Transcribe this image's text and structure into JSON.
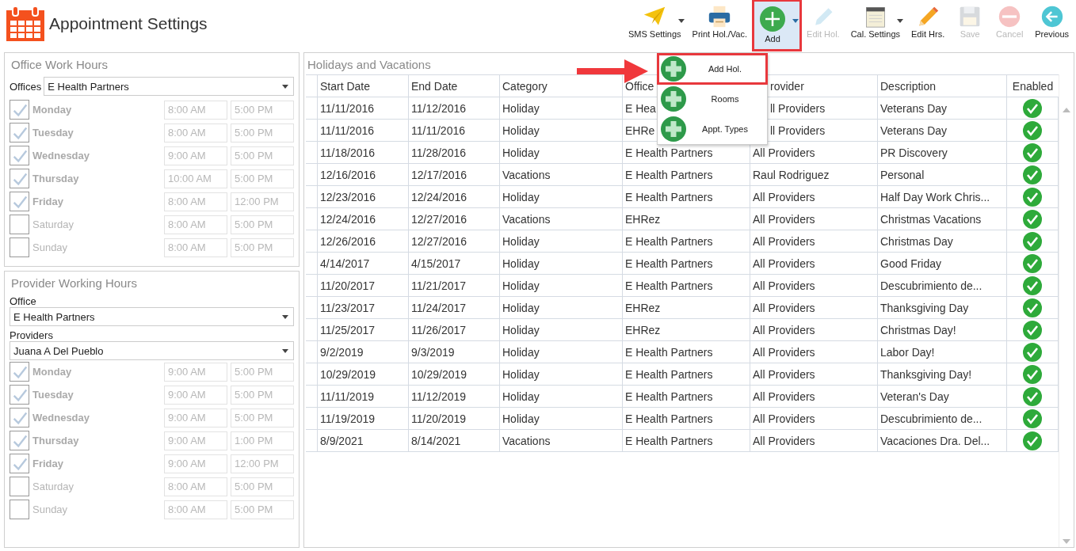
{
  "window": {
    "title": "Appointment Settings"
  },
  "toolbar": [
    {
      "label": "SMS Settings",
      "kind": "plane",
      "disabled": false,
      "has_menu": true,
      "selected": false
    },
    {
      "label": "Print Hol./Vac.",
      "kind": "printer",
      "disabled": false,
      "has_menu": false,
      "selected": false
    },
    {
      "label": "Add",
      "kind": "add",
      "disabled": false,
      "has_menu": true,
      "selected": true
    },
    {
      "label": "Edit Hol.",
      "kind": "edit",
      "disabled": true,
      "has_menu": false,
      "selected": false
    },
    {
      "label": "Cal. Settings",
      "kind": "notepad",
      "disabled": false,
      "has_menu": true,
      "selected": false
    },
    {
      "label": "Edit Hrs.",
      "kind": "pencil",
      "disabled": false,
      "has_menu": false,
      "selected": false
    },
    {
      "label": "Save",
      "kind": "save",
      "disabled": true,
      "has_menu": false,
      "selected": false
    },
    {
      "label": "Cancel",
      "kind": "cancel",
      "disabled": true,
      "has_menu": false,
      "selected": false
    },
    {
      "label": "Previous",
      "kind": "back",
      "disabled": false,
      "has_menu": false,
      "selected": false
    }
  ],
  "add_menu": {
    "open": true,
    "items": [
      {
        "label": "Add Hol.",
        "selected": true
      },
      {
        "label": "Rooms",
        "selected": false
      },
      {
        "label": "Appt. Types",
        "selected": false
      }
    ]
  },
  "office_hours": {
    "title": "Office Work Hours",
    "offices_label": "Offices",
    "office": "E Health Partners",
    "days": [
      {
        "day": "Monday",
        "checked": true,
        "start": "8:00 AM",
        "end": "5:00 PM"
      },
      {
        "day": "Tuesday",
        "checked": true,
        "start": "8:00 AM",
        "end": "5:00 PM"
      },
      {
        "day": "Wednesday",
        "checked": true,
        "start": "9:00 AM",
        "end": "5:00 PM"
      },
      {
        "day": "Thursday",
        "checked": true,
        "start": "10:00 AM",
        "end": "5:00 PM"
      },
      {
        "day": "Friday",
        "checked": true,
        "start": "8:00 AM",
        "end": "12:00 PM"
      },
      {
        "day": "Saturday",
        "checked": false,
        "start": "8:00 AM",
        "end": "5:00 PM"
      },
      {
        "day": "Sunday",
        "checked": false,
        "start": "8:00 AM",
        "end": "5:00 PM"
      }
    ]
  },
  "provider_hours": {
    "title": "Provider Working Hours",
    "office_label": "Office",
    "office": "E Health Partners",
    "providers_label": "Providers",
    "provider": "Juana A Del Pueblo",
    "days": [
      {
        "day": "Monday",
        "checked": true,
        "start": "9:00 AM",
        "end": "5:00 PM"
      },
      {
        "day": "Tuesday",
        "checked": true,
        "start": "9:00 AM",
        "end": "5:00 PM"
      },
      {
        "day": "Wednesday",
        "checked": true,
        "start": "9:00 AM",
        "end": "5:00 PM"
      },
      {
        "day": "Thursday",
        "checked": true,
        "start": "9:00 AM",
        "end": "1:00 PM"
      },
      {
        "day": "Friday",
        "checked": true,
        "start": "9:00 AM",
        "end": "12:00 PM"
      },
      {
        "day": "Saturday",
        "checked": false,
        "start": "8:00 AM",
        "end": "5:00 PM"
      },
      {
        "day": "Sunday",
        "checked": false,
        "start": "8:00 AM",
        "end": "5:00 PM"
      }
    ]
  },
  "holidays": {
    "title": "Holidays and Vacations",
    "columns": [
      "Start Date",
      "End Date",
      "Category",
      "Office",
      "rovider",
      "Description",
      "Enabled"
    ],
    "rows": [
      {
        "start": "11/11/2016",
        "end": "11/12/2016",
        "category": "Holiday",
        "office": "E Hea",
        "provider": "ll Providers",
        "description": "Veterans Day",
        "enabled": true
      },
      {
        "start": "11/11/2016",
        "end": "11/11/2016",
        "category": "Holiday",
        "office": "EHRe",
        "provider": "ll Providers",
        "description": "Veterans Day",
        "enabled": true
      },
      {
        "start": "11/18/2016",
        "end": "11/28/2016",
        "category": "Holiday",
        "office": "E Health Partners",
        "provider": "All Providers",
        "description": "PR Discovery",
        "enabled": true
      },
      {
        "start": "12/16/2016",
        "end": "12/17/2016",
        "category": "Vacations",
        "office": "E Health Partners",
        "provider": "Raul Rodriguez",
        "description": "Personal",
        "enabled": true
      },
      {
        "start": "12/23/2016",
        "end": "12/24/2016",
        "category": "Holiday",
        "office": "E Health Partners",
        "provider": "All Providers",
        "description": "Half Day Work Chris...",
        "enabled": true
      },
      {
        "start": "12/24/2016",
        "end": "12/27/2016",
        "category": "Vacations",
        "office": "EHRez",
        "provider": "All Providers",
        "description": "Christmas Vacations",
        "enabled": true
      },
      {
        "start": "12/26/2016",
        "end": "12/27/2016",
        "category": "Holiday",
        "office": "E Health Partners",
        "provider": "All Providers",
        "description": "Christmas Day",
        "enabled": true
      },
      {
        "start": "4/14/2017",
        "end": "4/15/2017",
        "category": "Holiday",
        "office": "E Health Partners",
        "provider": "All Providers",
        "description": "Good Friday",
        "enabled": true
      },
      {
        "start": "11/20/2017",
        "end": "11/21/2017",
        "category": "Holiday",
        "office": "E Health Partners",
        "provider": "All Providers",
        "description": "Descubrimiento de...",
        "enabled": true
      },
      {
        "start": "11/23/2017",
        "end": "11/24/2017",
        "category": "Holiday",
        "office": "EHRez",
        "provider": "All Providers",
        "description": "Thanksgiving Day",
        "enabled": true
      },
      {
        "start": "11/25/2017",
        "end": "11/26/2017",
        "category": "Holiday",
        "office": "EHRez",
        "provider": "All Providers",
        "description": "Christmas Day!",
        "enabled": true
      },
      {
        "start": "9/2/2019",
        "end": "9/3/2019",
        "category": "Holiday",
        "office": "E Health Partners",
        "provider": "All Providers",
        "description": "Labor Day!",
        "enabled": true
      },
      {
        "start": "10/29/2019",
        "end": "10/29/2019",
        "category": "Holiday",
        "office": "E Health Partners",
        "provider": "All Providers",
        "description": "Thanksgiving Day!",
        "enabled": true
      },
      {
        "start": "11/11/2019",
        "end": "11/12/2019",
        "category": "Holiday",
        "office": "E Health Partners",
        "provider": "All Providers",
        "description": "Veteran's Day",
        "enabled": true
      },
      {
        "start": "11/19/2019",
        "end": "11/20/2019",
        "category": "Holiday",
        "office": "E Health Partners",
        "provider": "All Providers",
        "description": "Descubrimiento de...",
        "enabled": true
      },
      {
        "start": "8/9/2021",
        "end": "8/14/2021",
        "category": "Vacations",
        "office": "E Health Partners",
        "provider": "All Providers",
        "description": "Vacaciones Dra. Del...",
        "enabled": true
      }
    ]
  }
}
